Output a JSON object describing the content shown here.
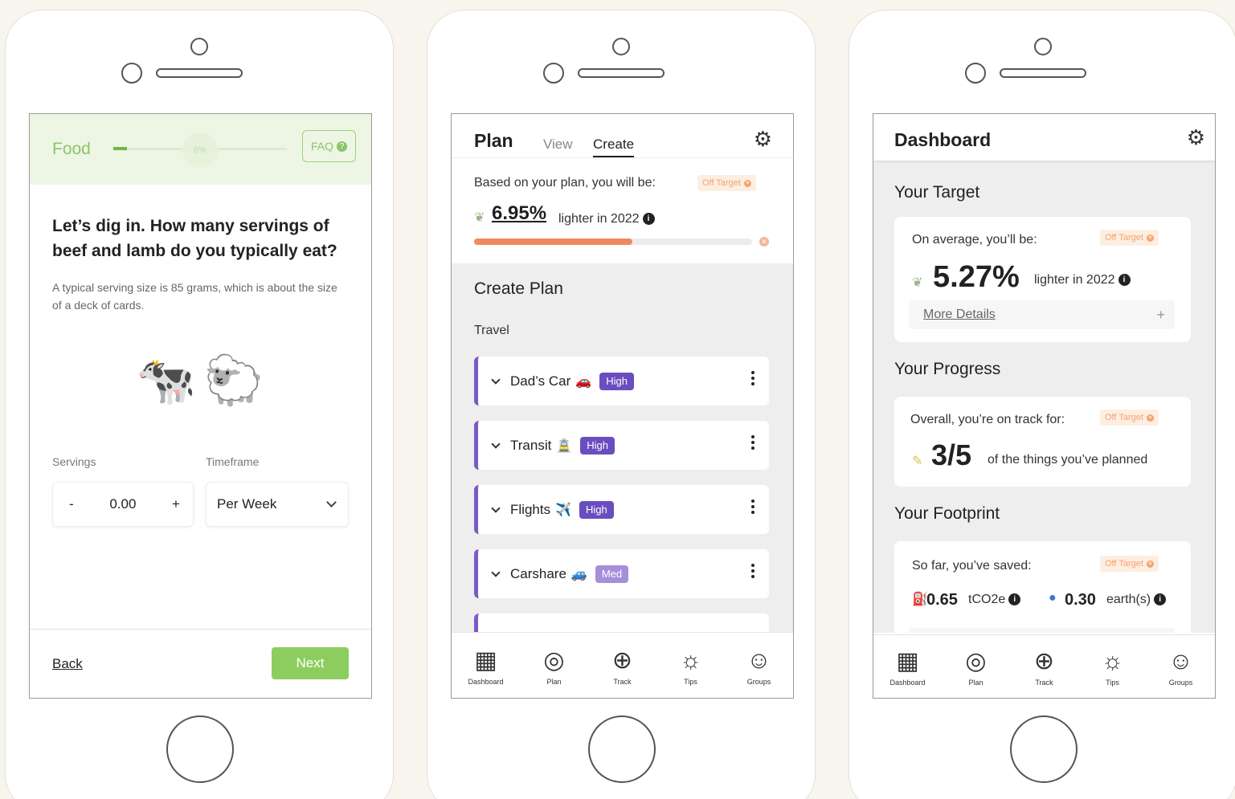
{
  "food": {
    "title": "Food",
    "progress_percent": "6%",
    "progress_fraction": 0.06,
    "faq_label": "FAQ",
    "question": "Let’s dig in. How many servings of beef and lamb do you typically eat?",
    "help_text": "A typical serving size is 85 grams, which is about the size of a deck of cards.",
    "animal_icons": [
      "🐄",
      "🐑"
    ],
    "servings_label": "Servings",
    "timeframe_label": "Timeframe",
    "servings_minus": "-",
    "servings_value": "0.00",
    "servings_plus": "+",
    "timeframe_value": "Per Week",
    "back_label": "Back",
    "next_label": "Next"
  },
  "plan": {
    "title": "Plan",
    "tabs": [
      {
        "label": "View"
      },
      {
        "label": "Create"
      }
    ],
    "active_tab": "Create",
    "based_text": "Based on your plan, you will be:",
    "off_target_label": "Off Target",
    "percent": "6.95%",
    "lighter_text": "lighter in 2022",
    "progress_fraction": 0.57,
    "section_title": "Create Plan",
    "category": "Travel",
    "items": [
      {
        "name": "Dad’s Car",
        "emoji": "🚗",
        "level": "High"
      },
      {
        "name": "Transit",
        "emoji": "🚊",
        "level": "High"
      },
      {
        "name": "Flights",
        "emoji": "✈️",
        "level": "High"
      },
      {
        "name": "Carshare",
        "emoji": "🚙",
        "level": "Med"
      }
    ]
  },
  "nav": [
    {
      "label": "Dashboard",
      "icon": "dashboard-icon"
    },
    {
      "label": "Plan",
      "icon": "target-icon"
    },
    {
      "label": "Track",
      "icon": "plus-circle-icon"
    },
    {
      "label": "Tips",
      "icon": "lightbulb-icon"
    },
    {
      "label": "Groups",
      "icon": "groups-icon"
    }
  ],
  "dashboard": {
    "title": "Dashboard",
    "target_title": "Your Target",
    "target_text": "On average, you’ll be:",
    "target_percent": "5.27%",
    "target_lighter": "lighter in 2022",
    "more_details": "More Details",
    "off_target_label": "Off Target",
    "progress_title": "Your Progress",
    "progress_text": "Overall, you’re on track for:",
    "progress_value": "3/5",
    "progress_suffix": "of the things you’ve planned",
    "footprint_title": "Your Footprint",
    "footprint_text": "So far, you’ve saved:",
    "co2_value": "0.65",
    "co2_unit": "tCO2e",
    "earth_value": "0.30",
    "earth_unit": "earth(s)"
  },
  "colors": {
    "food_green": "#8bc56a",
    "next_green": "#8dcd5f",
    "plan_purple": "#6a4dbf",
    "med_purple": "#a68fd8",
    "off_target_orange": "#f5a16b",
    "progress_orange": "#f08a5d"
  }
}
